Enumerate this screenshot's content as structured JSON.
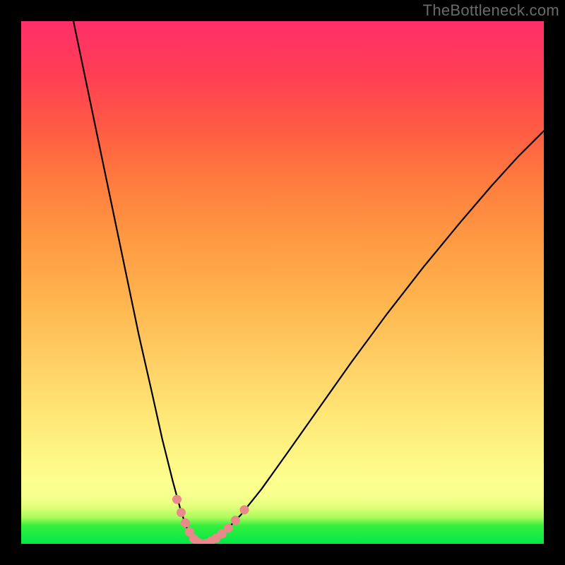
{
  "watermark": "TheBottleneck.com",
  "colors": {
    "frame_bg": "#000000",
    "gradient_top": "#ff2f6a",
    "gradient_mid_high": "#ff9a43",
    "gradient_mid": "#ffe877",
    "gradient_low": "#a8fb5b",
    "gradient_bottom": "#00e84a",
    "curve_stroke": "#000000",
    "marker_fill": "#e98989"
  },
  "chart_data": {
    "type": "line",
    "title": "",
    "xlabel": "",
    "ylabel": "",
    "xlim": [
      0,
      100
    ],
    "ylim": [
      0,
      100
    ],
    "grid": false,
    "curves": [
      {
        "name": "left-branch",
        "points": [
          {
            "x": 10.0,
            "y": 100.0
          },
          {
            "x": 12.5,
            "y": 88.0
          },
          {
            "x": 15.0,
            "y": 76.0
          },
          {
            "x": 17.5,
            "y": 64.0
          },
          {
            "x": 20.0,
            "y": 52.0
          },
          {
            "x": 22.5,
            "y": 40.0
          },
          {
            "x": 25.0,
            "y": 29.0
          },
          {
            "x": 27.0,
            "y": 20.0
          },
          {
            "x": 29.0,
            "y": 12.0
          },
          {
            "x": 30.5,
            "y": 6.5
          },
          {
            "x": 31.5,
            "y": 3.5
          },
          {
            "x": 32.3,
            "y": 1.8
          },
          {
            "x": 33.0,
            "y": 0.9
          },
          {
            "x": 33.8,
            "y": 0.3
          },
          {
            "x": 34.5,
            "y": 0.0
          }
        ]
      },
      {
        "name": "right-branch",
        "points": [
          {
            "x": 34.5,
            "y": 0.0
          },
          {
            "x": 35.5,
            "y": 0.2
          },
          {
            "x": 37.0,
            "y": 0.9
          },
          {
            "x": 39.0,
            "y": 2.4
          },
          {
            "x": 42.0,
            "y": 5.5
          },
          {
            "x": 46.0,
            "y": 10.5
          },
          {
            "x": 51.0,
            "y": 17.5
          },
          {
            "x": 57.0,
            "y": 26.0
          },
          {
            "x": 63.0,
            "y": 34.5
          },
          {
            "x": 70.0,
            "y": 44.0
          },
          {
            "x": 77.0,
            "y": 53.0
          },
          {
            "x": 84.0,
            "y": 61.5
          },
          {
            "x": 90.0,
            "y": 68.5
          },
          {
            "x": 95.0,
            "y": 74.0
          },
          {
            "x": 100.0,
            "y": 79.0
          }
        ]
      }
    ],
    "markers": [
      {
        "x": 29.8,
        "y": 8.5,
        "r": 1.6
      },
      {
        "x": 30.6,
        "y": 6.0,
        "r": 1.6
      },
      {
        "x": 31.4,
        "y": 4.0,
        "r": 1.6
      },
      {
        "x": 32.2,
        "y": 2.3,
        "r": 1.6
      },
      {
        "x": 33.0,
        "y": 1.0,
        "r": 1.6
      },
      {
        "x": 33.8,
        "y": 0.3,
        "r": 1.6
      },
      {
        "x": 34.5,
        "y": 0.0,
        "r": 1.6
      },
      {
        "x": 35.4,
        "y": 0.1,
        "r": 1.6
      },
      {
        "x": 36.3,
        "y": 0.5,
        "r": 1.6
      },
      {
        "x": 37.3,
        "y": 1.1,
        "r": 1.6
      },
      {
        "x": 38.4,
        "y": 1.9,
        "r": 1.6
      },
      {
        "x": 39.6,
        "y": 3.0,
        "r": 1.6
      },
      {
        "x": 41.0,
        "y": 4.5,
        "r": 1.6
      },
      {
        "x": 42.7,
        "y": 6.5,
        "r": 1.6
      }
    ]
  }
}
